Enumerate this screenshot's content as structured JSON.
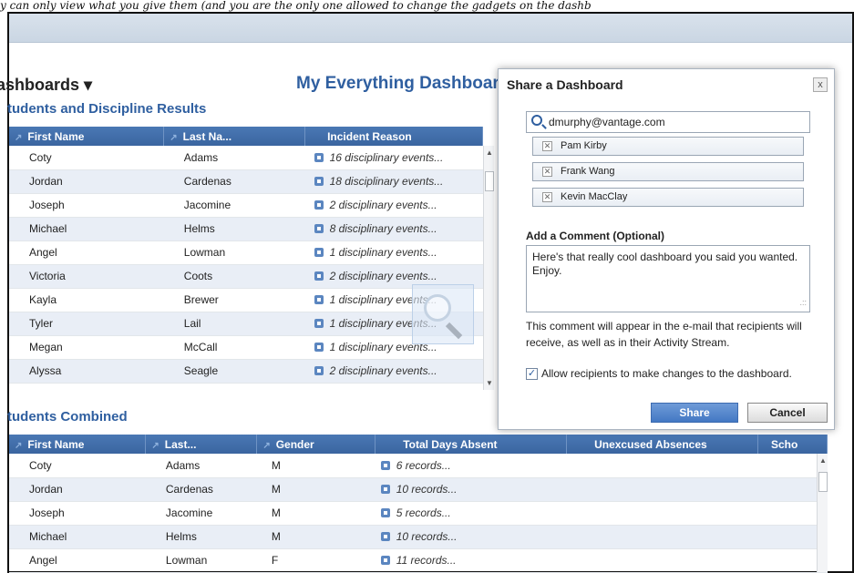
{
  "caption": "y can only view what you give them (and you are the only one allowed to change the gadgets on the dashb",
  "header": {
    "dashboards_menu": "ashboards ▾",
    "title": "My Everything Dashboard",
    "user_icon": "user-icon",
    "settings_icon": "gear-icon",
    "settings_caret": "▾"
  },
  "discipline": {
    "title": "tudents and Discipline Results",
    "columns": [
      "First Name",
      "Last Na...",
      "Incident Reason"
    ],
    "rows": [
      [
        "Coty",
        "Adams",
        "16 disciplinary events..."
      ],
      [
        "Jordan",
        "Cardenas",
        "18 disciplinary events..."
      ],
      [
        "Joseph",
        "Jacomine",
        "2 disciplinary events..."
      ],
      [
        "Michael",
        "Helms",
        "8 disciplinary events..."
      ],
      [
        "Angel",
        "Lowman",
        "1 disciplinary events..."
      ],
      [
        "Victoria",
        "Coots",
        "2 disciplinary events..."
      ],
      [
        "Kayla",
        "Brewer",
        "1 disciplinary events..."
      ],
      [
        "Tyler",
        "Lail",
        "1 disciplinary events..."
      ],
      [
        "Megan",
        "McCall",
        "1 disciplinary events..."
      ],
      [
        "Alyssa",
        "Seagle",
        "2 disciplinary events..."
      ]
    ]
  },
  "combined": {
    "title": "tudents Combined",
    "columns": [
      "First Name",
      "Last...",
      "Gender",
      "Total Days Absent",
      "Unexcused Absences",
      "Scho"
    ],
    "rows": [
      [
        "Coty",
        "Adams",
        "M",
        "6 records..."
      ],
      [
        "Jordan",
        "Cardenas",
        "M",
        "10 records..."
      ],
      [
        "Joseph",
        "Jacomine",
        "M",
        "5 records..."
      ],
      [
        "Michael",
        "Helms",
        "M",
        "10 records..."
      ],
      [
        "Angel",
        "Lowman",
        "F",
        "11 records..."
      ]
    ]
  },
  "share_dialog": {
    "title": "Share a Dashboard",
    "close": "x",
    "search_value": "dmurphy@vantage.com",
    "recipients": [
      "Pam Kirby",
      "Frank Wang",
      "Kevin MacClay"
    ],
    "comment_label": "Add a Comment (Optional)",
    "comment_text": "Here's that really cool dashboard you said you wanted.  Enjoy.",
    "note": "This comment will appear in the e-mail that recipients will receive, as well as in their Activity Stream.",
    "allow_changes_label": "Allow recipients to make changes to the dashboard.",
    "allow_changes_checked": true,
    "share_button": "Share",
    "cancel_button": "Cancel"
  },
  "colors": {
    "accent": "#2f5fa0",
    "header_blue": "#3a65a0",
    "row_alt": "#e9eef6"
  }
}
